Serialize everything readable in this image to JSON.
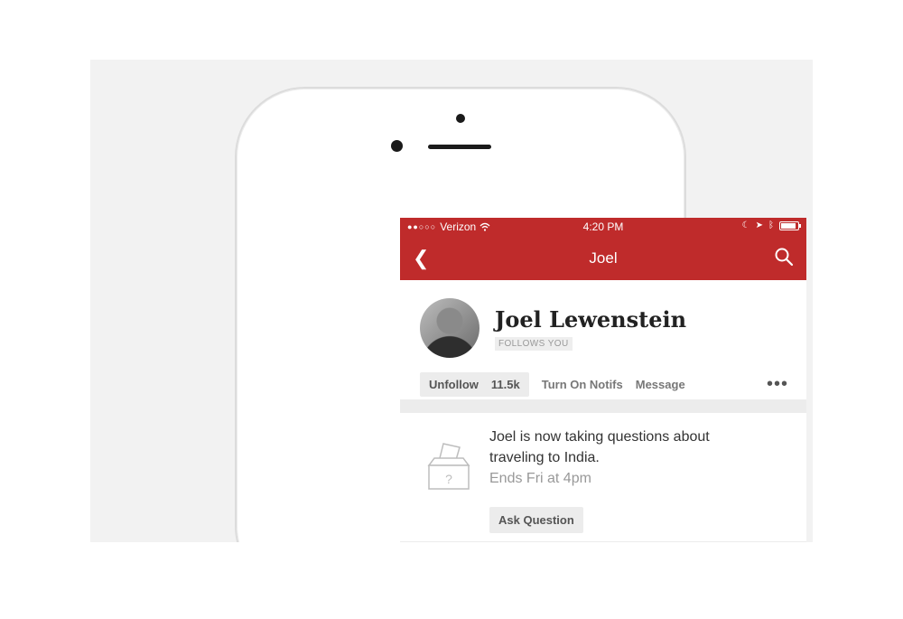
{
  "status_bar": {
    "carrier": "Verizon",
    "time": "4:20 PM"
  },
  "nav": {
    "title": "Joel"
  },
  "profile": {
    "name": "Joel Lewenstein",
    "follows_badge": "FOLLOWS YOU",
    "unfollow_label": "Unfollow",
    "follower_count": "11.5k",
    "notifs_label": "Turn On Notifs",
    "message_label": "Message",
    "more_label": "•••"
  },
  "question_card": {
    "text": "Joel is now taking questions about traveling to India.",
    "ends": "Ends Fri at 4pm",
    "ask_label": "Ask Question",
    "box_mark": "?"
  },
  "colors": {
    "brand_red": "#bf2b2b",
    "background": "#f2f2f2"
  }
}
